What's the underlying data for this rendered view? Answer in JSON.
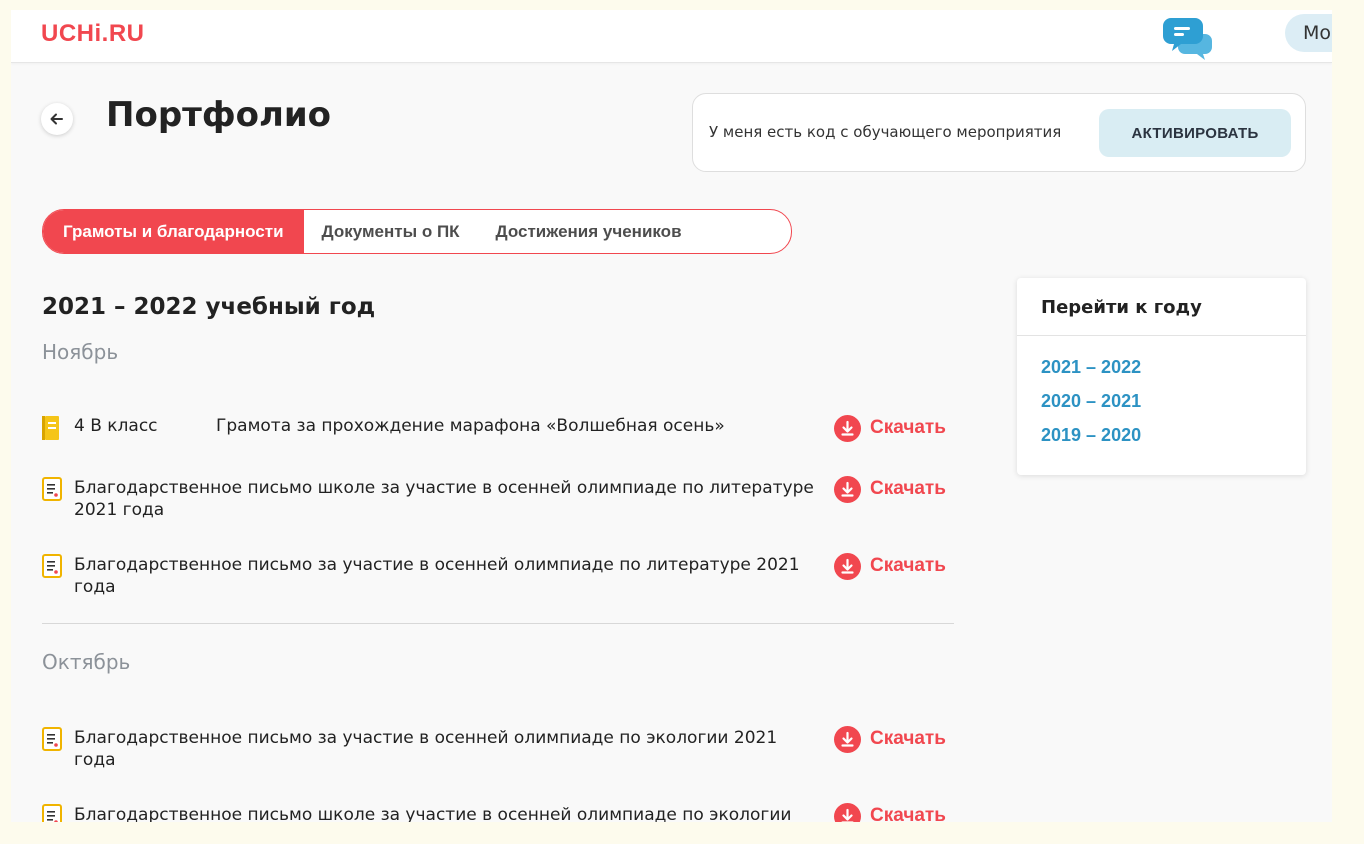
{
  "header": {
    "logo": "UCHi.RU",
    "profile_label": "Mo",
    "chat_icon": "chat-bubbles-icon",
    "brand_color": "#f1474f"
  },
  "page": {
    "title": "Портфолио",
    "back_icon": "arrow-left-icon"
  },
  "code_activation": {
    "text": "У меня есть код с обучающего мероприятия",
    "button_label": "АКТИВИРОВАТЬ"
  },
  "tabs": [
    {
      "label": "Грамоты и благодарности",
      "active": true
    },
    {
      "label": "Документы о ПК",
      "active": false
    },
    {
      "label": "Достижения учеников",
      "active": false
    }
  ],
  "content": {
    "year_heading": "2021 – 2022 учебный год",
    "download_label": "Скачать",
    "months": [
      {
        "name": "Ноябрь",
        "items": [
          {
            "icon": "certificate-icon",
            "class_label": "4 В класс",
            "title": "Грамота за прохождение марафона «Волшебная осень»"
          },
          {
            "icon": "letter-document-icon",
            "title": "Благодарственное письмо школе за участие в осенней олимпиаде по литературе 2021 года"
          },
          {
            "icon": "letter-document-icon",
            "title": "Благодарственное письмо за участие в осенней олимпиаде по литературе 2021 года"
          }
        ]
      },
      {
        "name": "Октябрь",
        "items": [
          {
            "icon": "letter-document-icon",
            "title": "Благодарственное письмо за участие в осенней олимпиаде по экологии 2021 года"
          },
          {
            "icon": "letter-document-icon",
            "title": "Благодарственное письмо школе за участие в осенней олимпиаде по экологии"
          }
        ]
      }
    ]
  },
  "year_nav": {
    "title": "Перейти к году",
    "years": [
      "2021 – 2022",
      "2020 – 2021",
      "2019 – 2020"
    ],
    "link_color": "#2c92c3"
  }
}
